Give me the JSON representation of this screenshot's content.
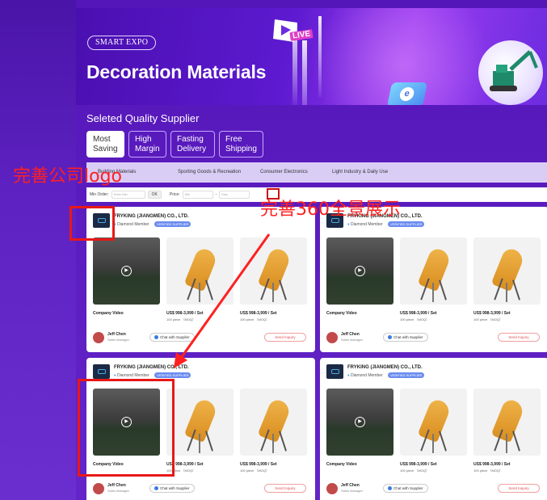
{
  "banner": {
    "badge": "SMART EXPO",
    "title": "Decoration Materials",
    "live_tag": "LIVE",
    "icons": [
      "play-tile-icon",
      "search-tile-icon",
      "excavator-icon"
    ]
  },
  "section": {
    "title": "Seleted Quality Supplier",
    "tabs": [
      {
        "line1": "Most",
        "line2": "Saving",
        "active": true
      },
      {
        "line1": "High",
        "line2": "Margin",
        "active": false
      },
      {
        "line1": "Fasting",
        "line2": "Delivery",
        "active": false
      },
      {
        "line1": "Free",
        "line2": "Shipping",
        "active": false
      }
    ]
  },
  "categories": [
    "Building Materials",
    "Sporting Goods & Recreation",
    "Consumer Electronics",
    "Light Industry & Daily Use"
  ],
  "filter": {
    "min_order_label": "Min Order:",
    "min_order_placeholder": "Enter Min",
    "ok_label": "OK",
    "price_label": "Price:",
    "price_min_placeholder": "Min",
    "price_max_placeholder": "Max"
  },
  "cards": [
    {
      "company": "FRYKING (JIANGMEN) CO., LTD.",
      "member": "Diamond Member",
      "verify": "VERIFIED SUPPLIER",
      "video_label": "Company Video",
      "products": [
        {
          "price": "US$ 998-3,999 / Set",
          "moq": "100 piece （MOQ）"
        },
        {
          "price": "US$ 998-3,999 / Set",
          "moq": "100 piece （MOQ）"
        }
      ],
      "person": "Jeff Chen",
      "role": "Sales Manager",
      "chat": "Chat with Supplier",
      "inquiry": "Send Inquiry"
    },
    {
      "company": "FRYKING (JIANGMEN) CO., LTD.",
      "member": "Diamond Member",
      "verify": "VERIFIED SUPPLIER",
      "video_label": "Company Video",
      "products": [
        {
          "price": "US$ 998-3,999 / Set",
          "moq": "100 piece （MOQ）"
        },
        {
          "price": "US$ 998-3,999 / Set",
          "moq": "100 piece （MOQ）"
        }
      ],
      "person": "Jeff Chen",
      "role": "Sales Manager",
      "chat": "Chat with Supplier",
      "inquiry": "Send Inquiry"
    },
    {
      "company": "FRYKING (JIANGMEN) CO., LTD.",
      "member": "Diamond Member",
      "verify": "VERIFIED SUPPLIER",
      "video_label": "Company Video",
      "products": [
        {
          "price": "US$ 998-3,999 / Set",
          "moq": "100 piece （MOQ）"
        },
        {
          "price": "US$ 998-3,999 / Set",
          "moq": "100 piece （MOQ）"
        }
      ],
      "person": "Jeff Chen",
      "role": "Sales Manager",
      "chat": "Chat with Supplier",
      "inquiry": "Send Inquiry"
    },
    {
      "company": "FRYKING (JIANGMEN) CO., LTD.",
      "member": "Diamond Member",
      "verify": "VERIFIED SUPPLIER",
      "video_label": "Company Video",
      "products": [
        {
          "price": "US$ 998-3,999 / Set",
          "moq": "100 piece （MOQ）"
        },
        {
          "price": "US$ 998-3,999 / Set",
          "moq": "100 piece （MOQ）"
        }
      ],
      "person": "Jeff Chen",
      "role": "Sales Manager",
      "chat": "Chat with Supplier",
      "inquiry": "Send Inquiry"
    }
  ],
  "annotations": {
    "logo_note": "完善公司logo",
    "panorama_note": "完善360全景展示",
    "color": "#ff2020"
  }
}
